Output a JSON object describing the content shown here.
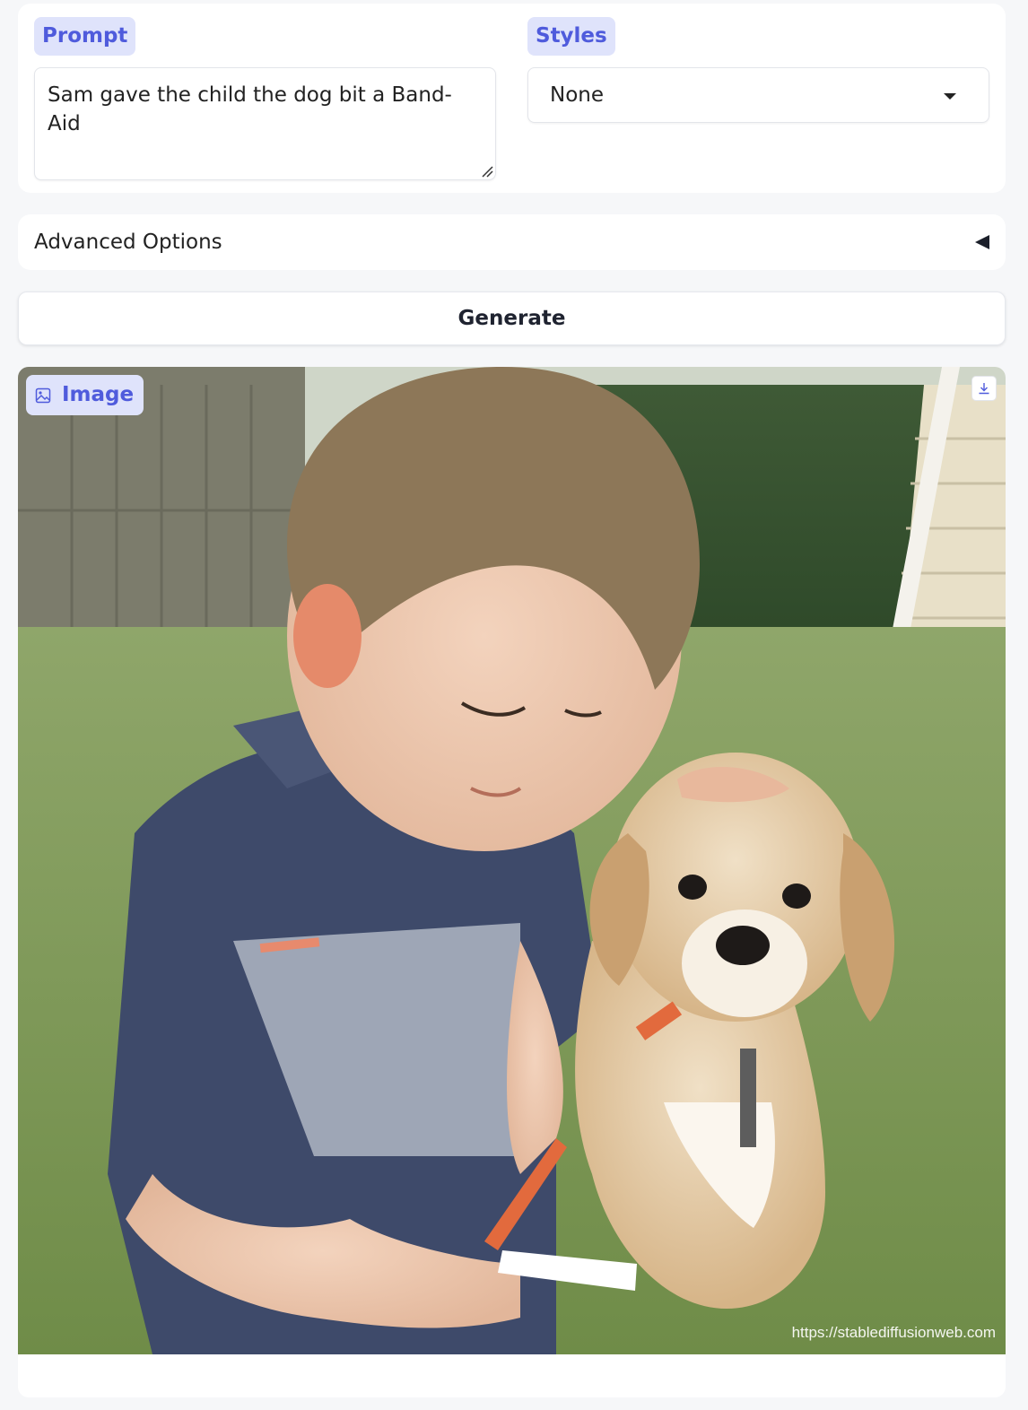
{
  "prompt": {
    "label": "Prompt",
    "value": "Sam gave the child the dog bit a Band-Aid"
  },
  "styles": {
    "label": "Styles",
    "selected": "None"
  },
  "advanced": {
    "label": "Advanced Options"
  },
  "generate": {
    "label": "Generate"
  },
  "output": {
    "label": "Image",
    "watermark": "https://stablediffusionweb.com",
    "image_description": "Generated photo: a young boy in a navy polo shirt kneeling on a lawn holding a white strip, petting a tan puppy with an orange collar; fence and hedge in background"
  },
  "icons": {
    "image_icon": "image-icon",
    "download_icon": "download-icon",
    "dropdown_icon": "chevron-down-icon",
    "accordion_icon": "triangle-left-icon"
  },
  "colors": {
    "accent": "#4f5bdc",
    "chip_bg": "#dfe3fb",
    "background": "#f6f7f9"
  }
}
